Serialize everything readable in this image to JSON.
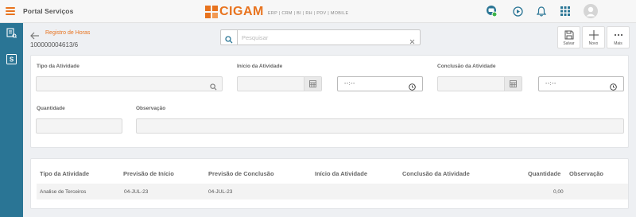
{
  "topbar": {
    "title": "Portal Serviços",
    "logo_text": "CIGAM",
    "logo_sub": "ERP | CRM | BI | RH | PDV | MOBILE",
    "accent": "#e8731e",
    "sidebar_color": "#2a7595"
  },
  "header": {
    "breadcrumb": "Registro de Horas",
    "record_id": "100000004613/6",
    "search_placeholder": "Pesquisar",
    "actions": [
      {
        "label": "Salvar",
        "icon": "save-icon"
      },
      {
        "label": "Novo",
        "icon": "plus-icon"
      },
      {
        "label": "Mais",
        "icon": "more-icon"
      }
    ]
  },
  "form": {
    "tipo_label": "Tipo da Atividade",
    "inicio_label": "Início da Atividade",
    "conclusao_label": "Conclusão da Atividade",
    "quantidade_label": "Quantidade",
    "observacao_label": "Observação",
    "time_placeholder": "--:--"
  },
  "table": {
    "columns": [
      "Tipo da Atividade",
      "Previsão de Início",
      "Previsão de Conclusão",
      "Início da Atividade",
      "Conclusão da Atividade",
      "Quantidade",
      "Observação"
    ],
    "rows": [
      {
        "tipo": "Analise de Terceiros",
        "prev_inicio": "04-JUL-23",
        "prev_conclusao": "04-JUL-23",
        "inicio": "",
        "conclusao": "",
        "quantidade": "0,00",
        "observacao": ""
      }
    ]
  }
}
